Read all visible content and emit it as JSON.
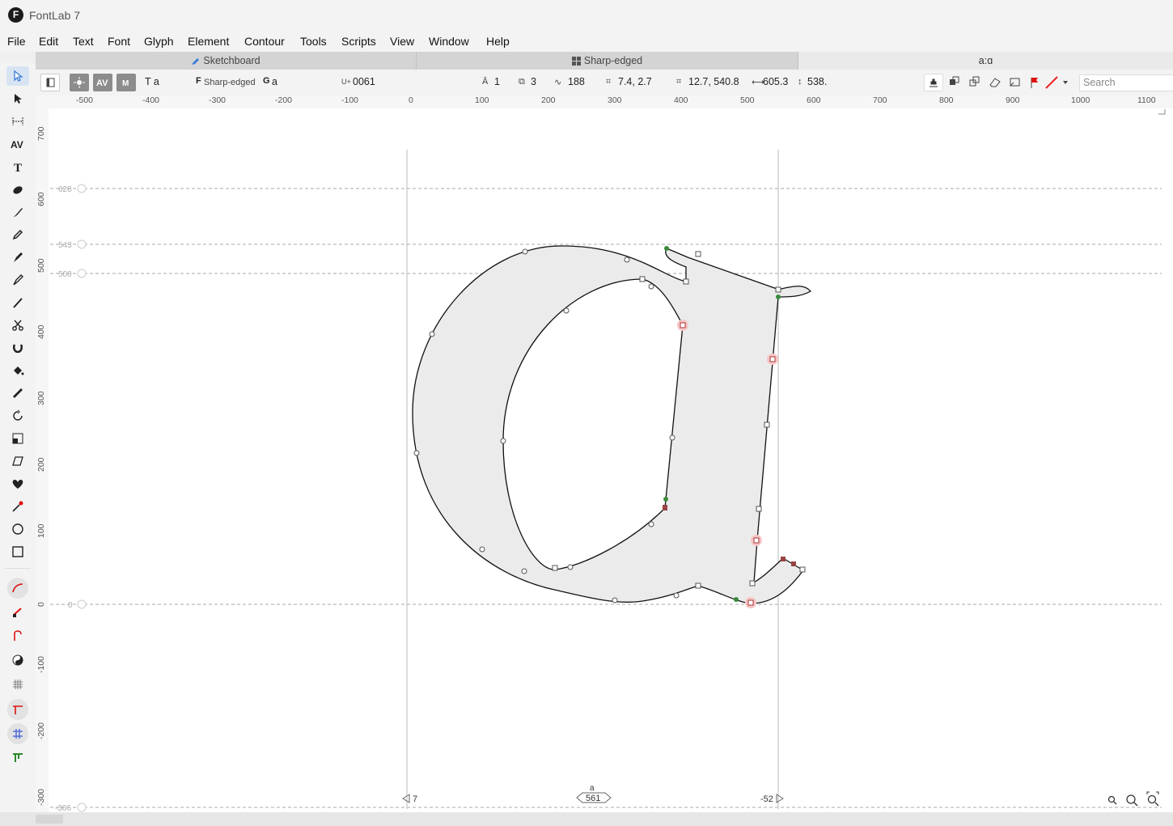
{
  "app": {
    "title": "FontLab 7",
    "logo_letter": "F"
  },
  "menu": [
    "File",
    "Edit",
    "Text",
    "Font",
    "Glyph",
    "Element",
    "Contour",
    "Tools",
    "Scripts",
    "View",
    "Window",
    "Help"
  ],
  "tabs": {
    "sketchboard": "Sketchboard",
    "font": "Sharp-edged",
    "glyph": "a:ɑ"
  },
  "properties": {
    "text_mode": "T a",
    "font_name": "Sharp-edged",
    "glyph_letter": "a",
    "unicode": "0061",
    "layers": "1",
    "elements": "3",
    "nodes": "188",
    "position": "7.4, 2.7",
    "size": "12.7, 540.8",
    "width": "605.3",
    "height": "538.",
    "search_placeholder": "Search"
  },
  "ruler": {
    "top_ticks": [
      "-500",
      "-400",
      "-300",
      "-200",
      "-100",
      "0",
      "100",
      "200",
      "300",
      "400",
      "500",
      "600",
      "700",
      "800",
      "900",
      "1000",
      "1100"
    ],
    "left_ticks": [
      "700",
      "600",
      "500",
      "400",
      "300",
      "200",
      "100",
      "0",
      "-100",
      "-200",
      "-300"
    ]
  },
  "guides": {
    "ascender": "628",
    "cap_height": "543",
    "x_height": "500",
    "baseline": "0",
    "descender": "-306"
  },
  "metrics": {
    "lsb": "7",
    "advance": "561",
    "rsb": "-52",
    "glyph_label": "a"
  }
}
